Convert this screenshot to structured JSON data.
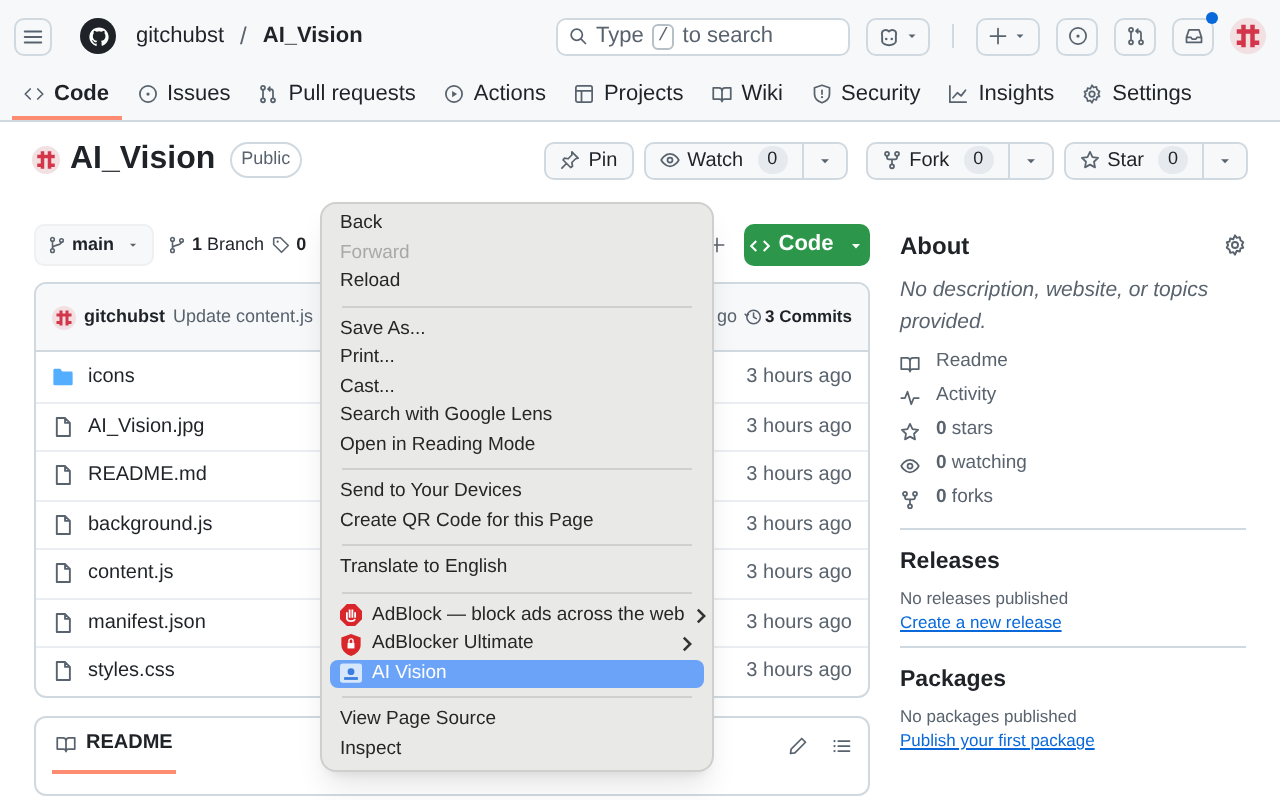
{
  "header": {
    "owner": "gitchubst",
    "separator": "/",
    "repo": "AI_Vision",
    "search": {
      "before": "Type",
      "key": "/",
      "after": "to search"
    },
    "notifications_unread": true
  },
  "tabs": [
    {
      "label": "Code",
      "selected": true
    },
    {
      "label": "Issues",
      "selected": false
    },
    {
      "label": "Pull requests",
      "selected": false
    },
    {
      "label": "Actions",
      "selected": false
    },
    {
      "label": "Projects",
      "selected": false
    },
    {
      "label": "Wiki",
      "selected": false
    },
    {
      "label": "Security",
      "selected": false
    },
    {
      "label": "Insights",
      "selected": false
    },
    {
      "label": "Settings",
      "selected": false
    }
  ],
  "repo": {
    "name": "AI_Vision",
    "visibility": "Public"
  },
  "repo_actions": [
    {
      "label": "Pin"
    },
    {
      "label": "Watch",
      "count": "0"
    },
    {
      "label": "Fork",
      "count": "0"
    },
    {
      "label": "Star",
      "count": "0"
    }
  ],
  "toolbar": {
    "branch": "main",
    "branches": "**1** Branch",
    "tags": "0",
    "code_button": "Code"
  },
  "latest_commit": {
    "author": "gitchubst",
    "message": "Update content.js",
    "time": "go",
    "commits": "3 Commits"
  },
  "files": [
    {
      "name": "icons",
      "kind": "folder",
      "updated": "3 hours ago"
    },
    {
      "name": "AI_Vision.jpg",
      "kind": "file",
      "updated": "3 hours ago"
    },
    {
      "name": "README.md",
      "kind": "file",
      "updated": "3 hours ago"
    },
    {
      "name": "background.js",
      "kind": "file",
      "updated": "3 hours ago"
    },
    {
      "name": "content.js",
      "kind": "file",
      "updated": "3 hours ago"
    },
    {
      "name": "manifest.json",
      "kind": "file",
      "updated": "3 hours ago"
    },
    {
      "name": "styles.css",
      "kind": "file",
      "updated": "3 hours ago"
    }
  ],
  "readme_tab": "README",
  "about": {
    "title": "About",
    "description": "No description, website, or topics provided.",
    "stats": [
      "Readme",
      "Activity",
      "**0** stars",
      "**0** watching",
      "**0** forks"
    ]
  },
  "releases": {
    "title": "Releases",
    "note": "No releases published",
    "link": "Create a new release"
  },
  "packages": {
    "title": "Packages",
    "note": "No packages published",
    "link": "Publish your first package"
  },
  "context_menu": {
    "groups": [
      [
        {
          "label": "Back",
          "kind": "plain",
          "disabled": false,
          "selected": false,
          "submenu": false
        },
        {
          "label": "Forward",
          "kind": "plain",
          "disabled": true,
          "selected": false,
          "submenu": false
        },
        {
          "label": "Reload",
          "kind": "plain",
          "disabled": false,
          "selected": false,
          "submenu": false
        }
      ],
      [
        {
          "label": "Save As...",
          "kind": "plain",
          "disabled": false,
          "selected": false,
          "submenu": false
        },
        {
          "label": "Print...",
          "kind": "plain",
          "disabled": false,
          "selected": false,
          "submenu": false
        },
        {
          "label": "Cast...",
          "kind": "plain",
          "disabled": false,
          "selected": false,
          "submenu": false
        },
        {
          "label": "Search with Google Lens",
          "kind": "plain",
          "disabled": false,
          "selected": false,
          "submenu": false
        },
        {
          "label": "Open in Reading Mode",
          "kind": "plain",
          "disabled": false,
          "selected": false,
          "submenu": false
        }
      ],
      [
        {
          "label": "Send to Your Devices",
          "kind": "plain",
          "disabled": false,
          "selected": false,
          "submenu": false
        },
        {
          "label": "Create QR Code for this Page",
          "kind": "plain",
          "disabled": false,
          "selected": false,
          "submenu": false
        }
      ],
      [
        {
          "label": "Translate to English",
          "kind": "plain",
          "disabled": false,
          "selected": false,
          "submenu": false
        }
      ],
      [
        {
          "label": "AdBlock — block ads across the web",
          "kind": "extension",
          "disabled": false,
          "selected": false,
          "submenu": true
        },
        {
          "label": "AdBlocker Ultimate",
          "kind": "extension",
          "disabled": false,
          "selected": false,
          "submenu": true
        },
        {
          "label": "AI Vision",
          "kind": "extension",
          "disabled": false,
          "selected": true,
          "submenu": false
        }
      ],
      [
        {
          "label": "View Page Source",
          "kind": "plain",
          "disabled": false,
          "selected": false,
          "submenu": false
        },
        {
          "label": "Inspect",
          "kind": "plain",
          "disabled": false,
          "selected": false,
          "submenu": false
        }
      ]
    ]
  }
}
